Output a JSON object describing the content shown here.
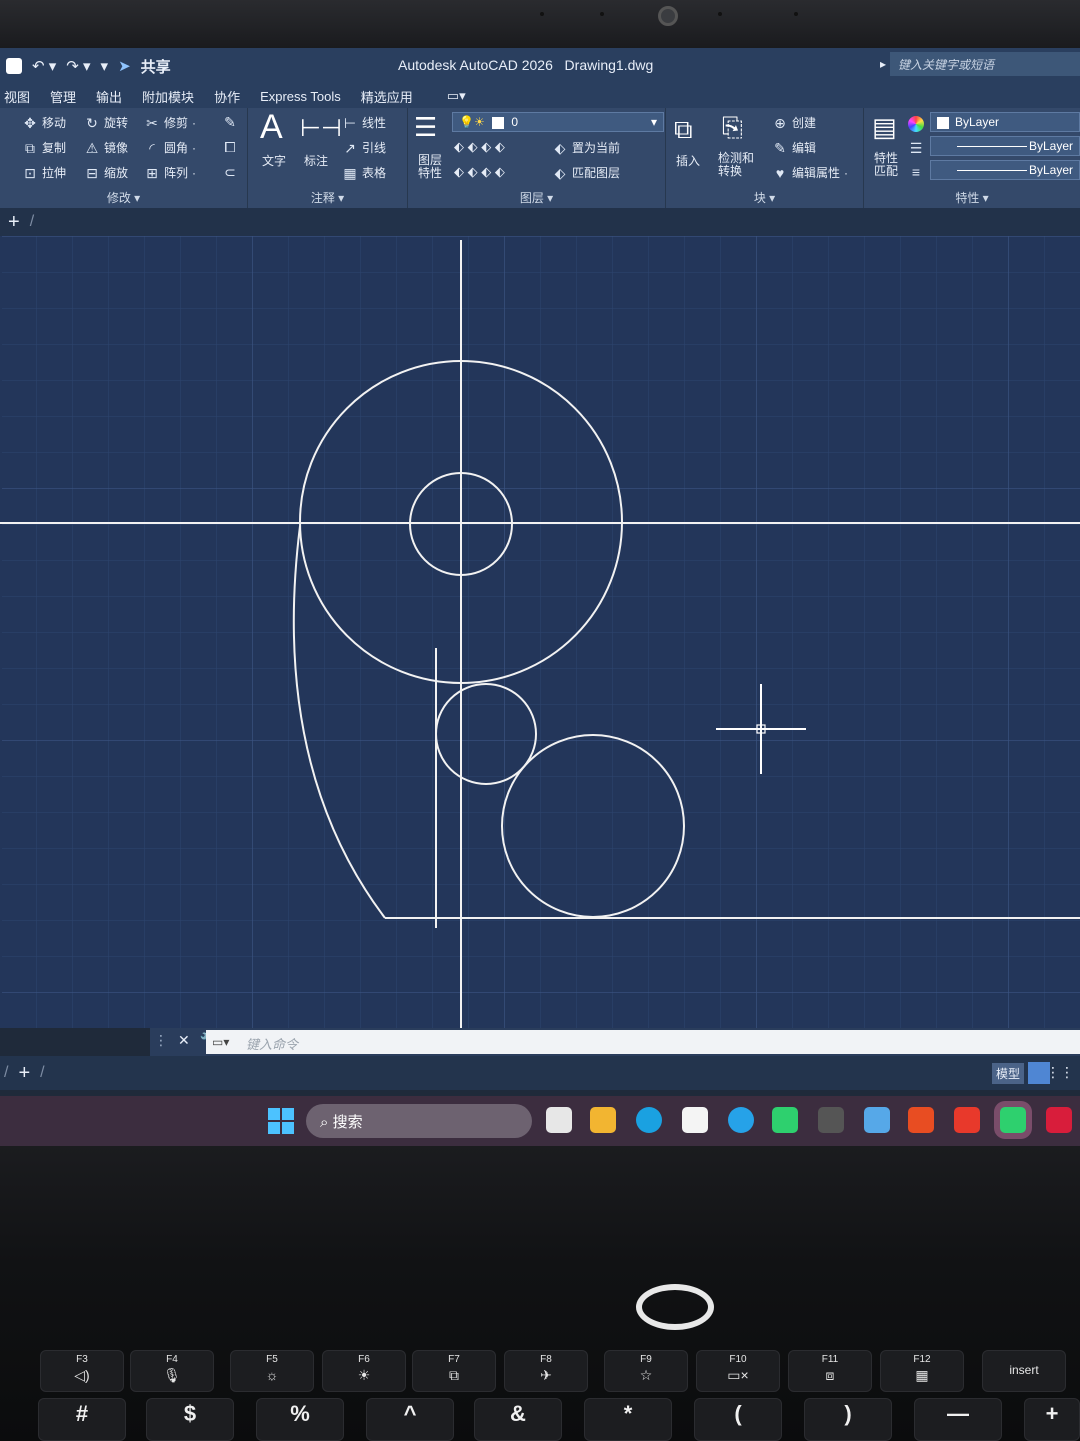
{
  "window": {
    "title": "Autodesk AutoCAD 2026   Drawing1.dwg",
    "share_label": "共享",
    "search_placeholder": "键入关键字或短语"
  },
  "menu": [
    "视图",
    "管理",
    "输出",
    "附加模块",
    "协作",
    "Express Tools",
    "精选应用"
  ],
  "ribbon": {
    "modify": {
      "label": "修改",
      "items": [
        "移动",
        "旋转",
        "修剪",
        "复制",
        "镜像",
        "圆角",
        "拉伸",
        "缩放",
        "阵列"
      ]
    },
    "annotation": {
      "label": "注释",
      "text": "文字",
      "dimension": "标注",
      "linear": "线性",
      "leader": "引线",
      "table": "表格"
    },
    "layers": {
      "label": "图层",
      "layer_props": "图层\n特性",
      "current_layer": "0",
      "set_current": "置为当前",
      "match_layer": "匹配图层"
    },
    "block": {
      "label": "块",
      "insert": "插入",
      "detect": "检测和\n转换",
      "create": "创建",
      "edit": "编辑",
      "edit_attr": "编辑属性"
    },
    "properties": {
      "label": "特性",
      "match": "特性\n匹配",
      "color": "ByLayer",
      "linetype": "ByLayer",
      "lineweight": "ByLayer"
    }
  },
  "command": {
    "placeholder": "键入命令"
  },
  "status": {
    "model": "模型"
  },
  "taskbar": {
    "search": "搜索"
  },
  "keyboard": {
    "fkeys": [
      "F3",
      "F4",
      "F5",
      "F6",
      "F7",
      "F8",
      "F9",
      "F10",
      "F11",
      "F12"
    ],
    "insert": "insert",
    "numbers": [
      "#",
      "$",
      "%",
      "^",
      "&",
      "*",
      "(",
      ")",
      "—",
      "+"
    ]
  },
  "colors": {
    "canvas": "#23365a",
    "ribbon": "#34496a",
    "titlebar": "#2a3f5f",
    "accent": "#4f86d3"
  }
}
